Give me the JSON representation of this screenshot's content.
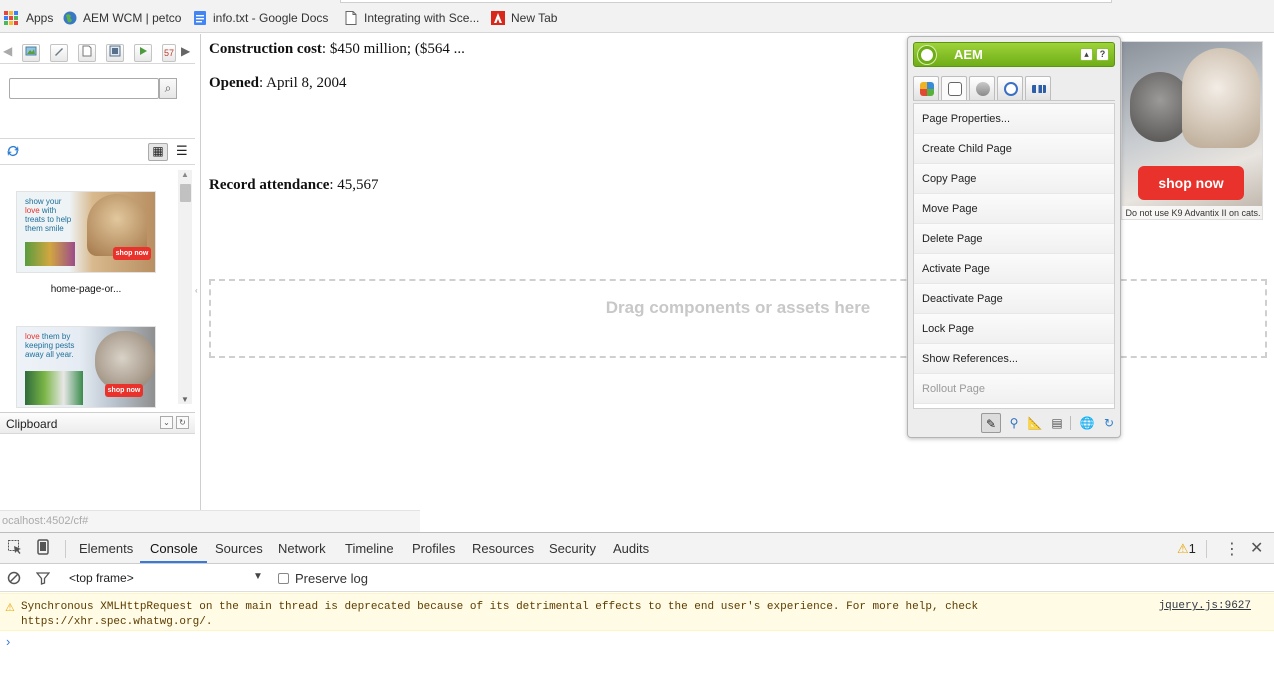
{
  "bookmarks": [
    {
      "label": "Apps",
      "icon": "apps-grid-icon"
    },
    {
      "label": "AEM WCM | petco",
      "icon": "globe-icon"
    },
    {
      "label": "info.txt - Google Docs",
      "icon": "google-docs-icon"
    },
    {
      "label": "Integrating with Sce...",
      "icon": "page-icon"
    },
    {
      "label": "New Tab",
      "icon": "adobe-icon"
    }
  ],
  "left_panel": {
    "search": {
      "value": "",
      "placeholder": ""
    },
    "assets": [
      {
        "label": "home-page-or...",
        "ad_text_line1": "show your",
        "ad_text_love": "love",
        "ad_text_line2": "with",
        "ad_text_line3": "treats to help",
        "ad_text_line4": "them smile",
        "cta": "shop now"
      },
      {
        "label": "",
        "ad_text_love": "love",
        "ad_text_line2": "them by",
        "ad_text_line3": "keeping pests",
        "ad_text_line4": "away all year.",
        "cta": "shop now"
      }
    ],
    "clipboard_title": "Clipboard",
    "status_url": "ocalhost:4502/cf#"
  },
  "content": {
    "construction_label": "Construction cost",
    "construction_value": ": $450 million; ($564 ...",
    "opened_label": "Opened",
    "opened_value": ": April 8, 2004",
    "attendance_label": "Record attendance",
    "attendance_value": ": 45,567",
    "dropzone_text": "Drag components or assets here"
  },
  "ad": {
    "cta": "shop now",
    "fine_print": "Do not use K9 Advantix II on cats."
  },
  "sidekick": {
    "title": "AEM",
    "collapse_label": "▴",
    "help_label": "?",
    "tabs": [
      "components-tab",
      "page-tab",
      "information-tab",
      "versioning-tab",
      "workflow-tab"
    ],
    "menu": [
      {
        "label": "Page Properties...",
        "enabled": true
      },
      {
        "label": "Create Child Page",
        "enabled": true
      },
      {
        "label": "Copy Page",
        "enabled": true
      },
      {
        "label": "Move Page",
        "enabled": true
      },
      {
        "label": "Delete Page",
        "enabled": true
      },
      {
        "label": "Activate Page",
        "enabled": true
      },
      {
        "label": "Deactivate Page",
        "enabled": true
      },
      {
        "label": "Lock Page",
        "enabled": true
      },
      {
        "label": "Show References...",
        "enabled": true
      },
      {
        "label": "Rollout Page",
        "enabled": false
      }
    ],
    "footer_buttons": [
      "edit-mode-pencil-icon",
      "preview-magnifier-icon",
      "design-mode-ruler-icon",
      "scaffolding-icon",
      "site-admin-globe-icon",
      "refresh-icon"
    ]
  },
  "devtools": {
    "tabs": [
      "Elements",
      "Console",
      "Sources",
      "Network",
      "Timeline",
      "Profiles",
      "Resources",
      "Security",
      "Audits"
    ],
    "active_tab": "Console",
    "warning_count": "1",
    "frame_selector": "<top frame>",
    "preserve_log_label": "Preserve log",
    "warning_message_line1": "Synchronous XMLHttpRequest on the main thread is deprecated because of its detrimental effects to the end user's experience. For more help, check",
    "warning_message_line2": "https://xhr.spec.whatwg.org/.",
    "warning_source": "jquery.js:9627",
    "prompt": "›"
  },
  "colors": {
    "aem_green": "#7ab51d",
    "devtools_accent": "#3879d9",
    "warning_bg": "#fffbe5",
    "ad_cta_red": "#e8322b"
  }
}
